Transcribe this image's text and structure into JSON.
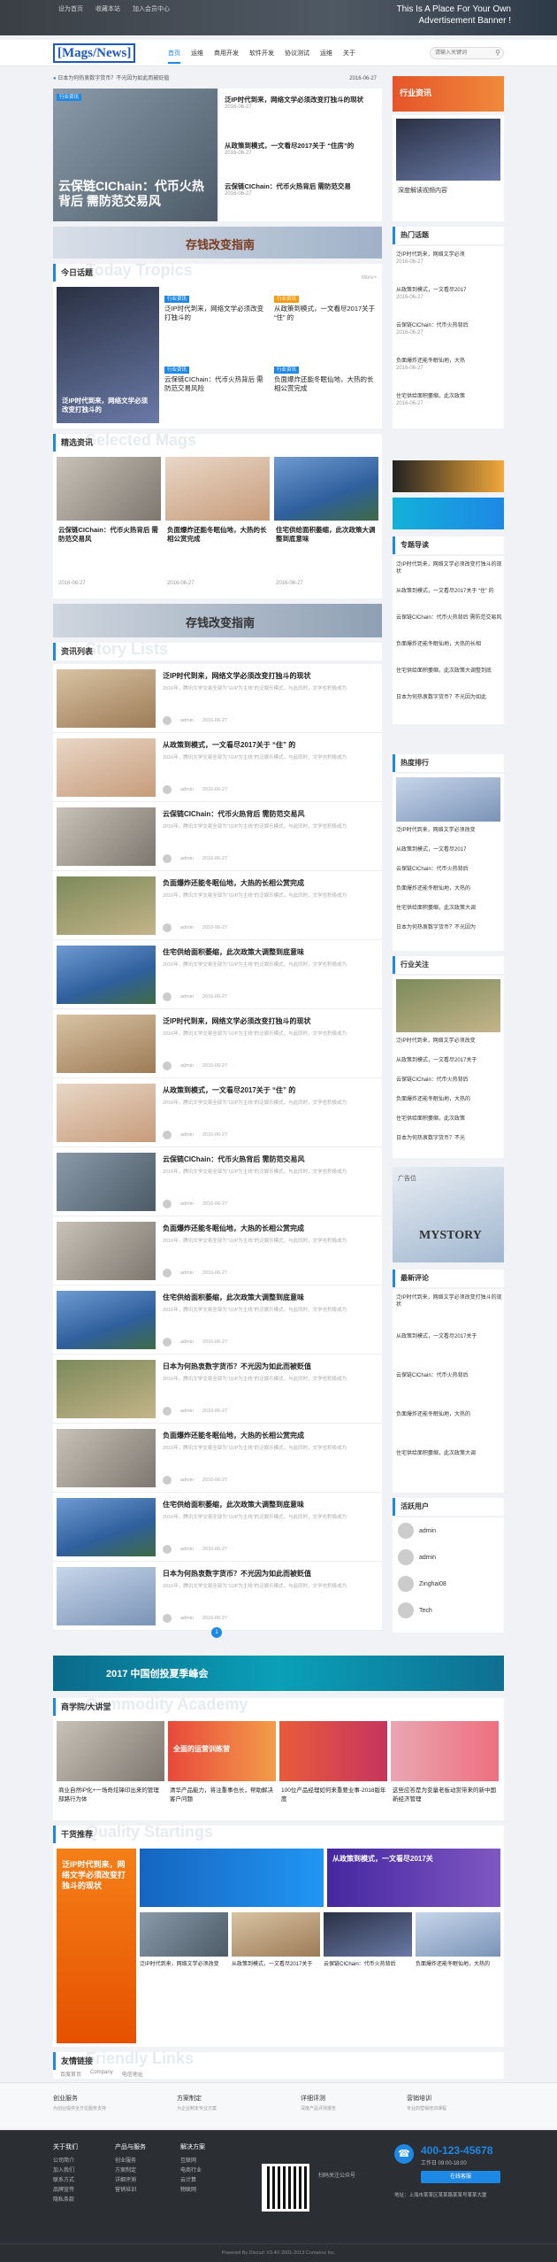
{
  "topbar": {
    "links": [
      "设为首页",
      "收藏本站",
      "加入会员中心"
    ],
    "ad_line1": "This Is A Place For Your Own",
    "ad_line2": "Advertisement Banner !"
  },
  "header": {
    "logo": "[Mags/News]",
    "nav": [
      "首页",
      "运维",
      "商用开发",
      "软件开发",
      "协议测试",
      "运维",
      "关于"
    ],
    "search_placeholder": "请输入关键词"
  },
  "notice": {
    "text": "日本为何热衷数字货币？不光因为如此而被贬值",
    "date": "2016-06-27"
  },
  "hero": {
    "slide_title": "云保链CIChain：代币火热\n背后 需防范交易风",
    "tag": "行业资讯",
    "list": [
      {
        "title": "泛IP时代到来，网络文学必须改变打独斗的现状",
        "date": "2016-06-27"
      },
      {
        "title": "从政策到模式，一文看尽2017关于 “住房”的",
        "date": "2016-06-27"
      },
      {
        "title": "云保链CIChain：代币火热背后 需防范交易",
        "date": "2016-06-27"
      }
    ]
  },
  "side_top": {
    "ad_text": "行业资讯",
    "video_title": "深度解读视频内容"
  },
  "banner_mid": {
    "text": "存钱改变指南"
  },
  "today": {
    "title": "今日话题",
    "ghost": "Today Tropics",
    "more": "More+",
    "items": [
      {
        "tag": "行业资讯",
        "title": "泛IP时代到来，网络文学必须改变打独斗的"
      },
      {
        "tag": "行业资讯",
        "title": "从政策到模式，一文看尽2017关于 “住” 的"
      },
      {
        "tag": "行业资讯",
        "title": "云保链CIChain：代币火热背后 需防范交易风险"
      },
      {
        "tag": "行业资讯",
        "title": "负面爆炸还能冬眠仙地，大热的长相公赏完成"
      }
    ],
    "main_title": "泛IP时代到来，网络文学必须改变打独斗的"
  },
  "selected": {
    "title": "精选资讯",
    "ghost": "Selected Mags",
    "items": [
      {
        "title": "云保链CIChain：代币火热背后 需防范交易风",
        "date": "2016-06-27"
      },
      {
        "title": "负面爆炸还能冬眠仙地，大热的长相公赏完成",
        "date": "2016-06-27"
      },
      {
        "title": "住宅供给面积萎缩，此次政策大调整到底意味",
        "date": "2016-06-27"
      }
    ]
  },
  "hot_tags": {
    "title": "热门话题",
    "items": [
      {
        "title": "泛IP时代到来，网络文学必须",
        "date": "2016-06-27"
      },
      {
        "title": "从政策到模式，一文看尽2017",
        "date": "2016-06-27"
      },
      {
        "title": "云保链CIChain：代币火热背后",
        "date": "2016-06-27"
      },
      {
        "title": "负面爆炸还能冬眠仙地，大热",
        "date": "2016-06-27"
      },
      {
        "title": "住宅供给面积萎缩，此次政策",
        "date": "2016-06-27"
      }
    ]
  },
  "news": {
    "title": "资讯列表",
    "ghost": "Story Lists",
    "desc": "2016年，腾讯文学交易全部为“以IP为主线”的泛娱乐模式，与此同时，文学也积极成为",
    "author": "admin",
    "date": "2016-06-27",
    "items": [
      "泛IP时代到来，网络文学必须改变打独斗的现状",
      "从政策到模式，一文看尽2017关于 “住” 的",
      "云保链CIChain：代币火热背后 需防范交易风",
      "负面爆炸还能冬眠仙地，大热的长相公赏完成",
      "住宅供给面积萎缩，此次政策大调整到底意味",
      "泛IP时代到来，网络文学必须改变打独斗的现状",
      "从政策到模式，一文看尽2017关于 “住” 的",
      "云保链CIChain：代币火热背后 需防范交易风",
      "负面爆炸还能冬眠仙地，大热的长相公赏完成",
      "住宅供给面积萎缩，此次政策大调整到底意味",
      "日本为何热衷数字货币？不光因为如此而被贬值",
      "负面爆炸还能冬眠仙地，大热的长相公赏完成",
      "住宅供给面积萎缩，此次政策大调整到底意味",
      "日本为何热衷数字货币？不光因为如此而被贬值"
    ],
    "pager": "1"
  },
  "topics": {
    "title": "专题导读",
    "items": [
      "泛IP时代到来，网络文学必须改变打独斗的现状",
      "从政策到模式，一文看尽2017关于 “住” 的",
      "云保链CIChain：代币火热背后 需防范交易风",
      "负面爆炸还能冬眠仙地，大热的长相",
      "住宅供给面积萎缩，此次政策大调整到底",
      "日本为何热衷数字货币？不光因为如此"
    ]
  },
  "hot_rank": {
    "title": "热度排行",
    "items": [
      "泛IP时代到来，网络文学必须改变",
      "从政策到模式，一文看尽2017",
      "云保链CIChain：代币火热背后",
      "负面爆炸还能冬眠仙地，大热的",
      "住宅供给面积萎缩，此次政策大调",
      "日本为何热衷数字货币？不光因为"
    ]
  },
  "focus": {
    "title": "行业关注",
    "items": [
      "泛IP时代到来，网络文学必须改变",
      "从政策到模式，一文看尽2017关于",
      "云保链CIChain：代币火热背后",
      "负面爆炸还能冬眠仙地，大热的",
      "住宅供给面积萎缩，此次政策",
      "日本为何热衷数字货币？不光"
    ]
  },
  "ad_side": {
    "text1": "广告位",
    "text2": "MYSTORY"
  },
  "comments": {
    "title": "最新评论",
    "items": [
      "泛IP时代到来，网络文学必须改变打独斗的现状",
      "从政策到模式，一文看尽2017关于",
      "云保链CIChain：代币火热背后",
      "负面爆炸还能冬眠仙地，大热的",
      "住宅供给面积萎缩，此次政策大调"
    ]
  },
  "users": {
    "title": "活跃用户",
    "items": [
      "admin",
      "admin",
      "Zinghai08",
      "Tech"
    ]
  },
  "banner_bottom": {
    "text": "2017 中国创投夏季峰会"
  },
  "academy": {
    "title": "商学院/大讲堂",
    "ghost": "Commodity Academy",
    "items": [
      "商业自然IP化+一场奇炫锋印出来的管理部路行为体",
      "清华产品能力，将注重事也长，帮助解决客户问题",
      "100位产品经理如何来重要业事-2018版年度",
      "这些应答是为变量老板动赏带来的新中国新经济管理"
    ],
    "big_title": "全面的运营训练营"
  },
  "tech": {
    "title": "干货推荐",
    "ghost": "Quality Startings",
    "items": [
      "泛IP时代到来，网络文学必须改变",
      "从政策到模式，一文看尽2017关于",
      "云保链CIChain：代币火热背后",
      "负面爆炸还能冬眠仙地，大热的"
    ],
    "big1": "泛IP时代到来，网络文学必须改变打独斗的现状",
    "big2": "从政策到模式，一文看尽2017关"
  },
  "friends": {
    "title": "友情链接",
    "ghost": "Friendly Links",
    "links": [
      "百度首页",
      "Company",
      "电信地址"
    ]
  },
  "services": [
    {
      "title": "创业服务",
      "sub": "为创业提供全方位服务支持"
    },
    {
      "title": "方案制定",
      "sub": "为企业制定专业方案"
    },
    {
      "title": "详细评测",
      "sub": "深度产品评测报告"
    },
    {
      "title": "营销培训",
      "sub": "专业的营销培训课程"
    }
  ],
  "footer": {
    "cols": [
      {
        "title": "关于我们",
        "items": [
          "公司简介",
          "加入我们",
          "联系方式",
          "品牌宣传",
          "隐私条款"
        ]
      },
      {
        "title": "产品与服务",
        "items": [
          "创业服务",
          "方案制定",
          "详细评测",
          "营销培训"
        ]
      },
      {
        "title": "解决方案",
        "items": [
          "互联网",
          "电商行业",
          "云计算",
          "物联网"
        ]
      }
    ],
    "qr_caption": "扫码关注公众号",
    "phone": "400-123-45678",
    "hours": "工作日 09:00-18:00",
    "button": "在线客服",
    "address": "地址：上海市某某区某某路某某号某某大厦",
    "copyright": "Powered By Discuz! X3.4© 2001-2013 Comsenz Inc."
  },
  "colors": {
    "accent": "#1e88e5",
    "dark": "#2b2e33"
  }
}
